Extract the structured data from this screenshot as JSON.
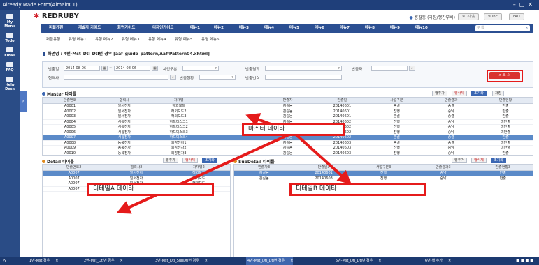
{
  "window": {
    "title": "Already Made Form(AlmaloC1)"
  },
  "leftbar": [
    {
      "label": "My\nMenu",
      "icon": "home-icon"
    },
    {
      "label": "Todo",
      "icon": "todo-icon"
    },
    {
      "label": "Email",
      "icon": "email-icon"
    },
    {
      "label": "FAQ",
      "icon": "faq-icon"
    },
    {
      "label": "Help\nDesk",
      "icon": "helpdesk-icon"
    }
  ],
  "header": {
    "logo": "REDRUBY",
    "user": "홍길동 (과장/행간부비)",
    "buttons": [
      "로그아웃",
      "VOBE",
      "FAQ"
    ],
    "gnb": [
      "퍼블개편",
      "개발자 가이드",
      "화면가이드",
      "디자인가이드",
      "메뉴1",
      "메뉴2",
      "메뉴3",
      "메뉴4",
      "메뉴5",
      "메뉴6",
      "메뉴7",
      "메뉴8",
      "메뉴9",
      "메뉴10"
    ],
    "search_placeholder": "검색",
    "lnb": [
      "퍼블유형",
      "유형 메뉴1",
      "유형 메뉴2",
      "유형 메뉴3",
      "유형 메뉴4",
      "유형 메뉴5",
      "유형 메뉴6"
    ]
  },
  "page_title": "화면명 : 4번-Mst_Dtl_Dtl번 경우 [aaf_guide_pattern/AaffPattern04.xhtml]",
  "search": {
    "fields": {
      "date_label": "반출일",
      "date_from": "2014-08-06",
      "date_to": "2014-08-06",
      "biz_label": "사업구분",
      "result_label": "반출결과",
      "person_label": "반출자",
      "partner_label": "협력사",
      "status_label": "반출현황",
      "no_label": "반출번호"
    },
    "button": "조 회"
  },
  "master": {
    "title": "Master 타이틀",
    "buttons": {
      "add": "행추가",
      "del": "행삭제",
      "reset": "초기화",
      "save": "저장"
    },
    "columns": [
      "반출번호",
      "협력사",
      "자재명",
      "",
      "반출자",
      "반출일",
      "사업구분",
      "반출결과",
      "반출현황"
    ],
    "rows": [
      [
        "A0001",
        "일서전자",
        "해외보드",
        "",
        "김길동",
        "20140601",
        "종결",
        "종결",
        "반출"
      ],
      [
        "A0002",
        "일서전자",
        "해외보드2",
        "",
        "김길동",
        "20140601",
        "진행",
        "승낙",
        "반출"
      ],
      [
        "A0003",
        "일서전자",
        "해외보드3",
        "",
        "김길동",
        "20140601",
        "종결",
        "종결",
        "반출"
      ],
      [
        "A0004",
        "서통전자",
        "하드디스크1",
        "",
        "김길동",
        "20140602",
        "진행",
        "승낙",
        "미반출"
      ],
      [
        "A0005",
        "서통전자",
        "하드디스크2",
        "",
        "김길동",
        "20140602",
        "진행",
        "승낙",
        "미반출"
      ],
      [
        "A0006",
        "서통전자",
        "하드디스크3",
        "",
        "김길동",
        "20140602",
        "진행",
        "승낙",
        "미반출"
      ],
      [
        "A0007",
        "서통전자",
        "하드디스크4",
        "",
        "김길동",
        "20140602",
        "종결",
        "종결",
        "반출"
      ],
      [
        "A0008",
        "동북전자",
        "회장전자1",
        "",
        "김길동",
        "20140603",
        "종결",
        "종결",
        "미반출"
      ],
      [
        "A0009",
        "동북전자",
        "회장전자2",
        "",
        "김길동",
        "20140603",
        "진행",
        "승낙",
        "미반출"
      ],
      [
        "A0010",
        "동북전자",
        "회장전자3",
        "",
        "김길동",
        "20140603",
        "진행",
        "승낙",
        "반출"
      ]
    ],
    "selected_row": 6
  },
  "detail": {
    "title": "Detail 타이틀",
    "buttons": {
      "add": "행추가",
      "del": "행삭제",
      "reset": "초기화"
    },
    "columns": [
      "반출번호2",
      "협력사2",
      "자재명2"
    ],
    "rows": [
      [
        "A0007",
        "일서전자",
        "해외보드"
      ],
      [
        "A0007",
        "일서전자",
        "해외보드"
      ],
      [
        "A0007",
        "일서전자",
        "해외보드"
      ],
      [
        "A0007",
        "일서전자",
        "해외보드"
      ]
    ]
  },
  "subdetail": {
    "title": "SubDetail 타이틀",
    "buttons": {
      "add": "행추가",
      "del": "행삭제",
      "reset": "초기화"
    },
    "columns": [
      "반출자3",
      "반출일3",
      "사업구분3",
      "반출결과3",
      "반출현황3"
    ],
    "rows": [
      [
        "김길동",
        "20140601",
        "진행",
        "승낙",
        "반출"
      ],
      [
        "김길동",
        "20140603",
        "진행",
        "승낙",
        "반출"
      ]
    ]
  },
  "callouts": {
    "master": "마스터 데이타",
    "detailA": "디테일A 데이타",
    "detailB": "디테일B 데이타"
  },
  "taskbar": [
    "1번-Mst 경우",
    "2번-Mst_Dtl번 경우",
    "3번-Mst_Dtl_SubDtl번 경우",
    "4번-Mst_Dtl_Dtl번 경우",
    "5번-Mst_Dtl_Dtl번 경우",
    "6번-행 추가"
  ],
  "colors": {
    "brand": "#2b4f92",
    "highlight": "#e51b1b",
    "selected": "#5b8ac8"
  }
}
